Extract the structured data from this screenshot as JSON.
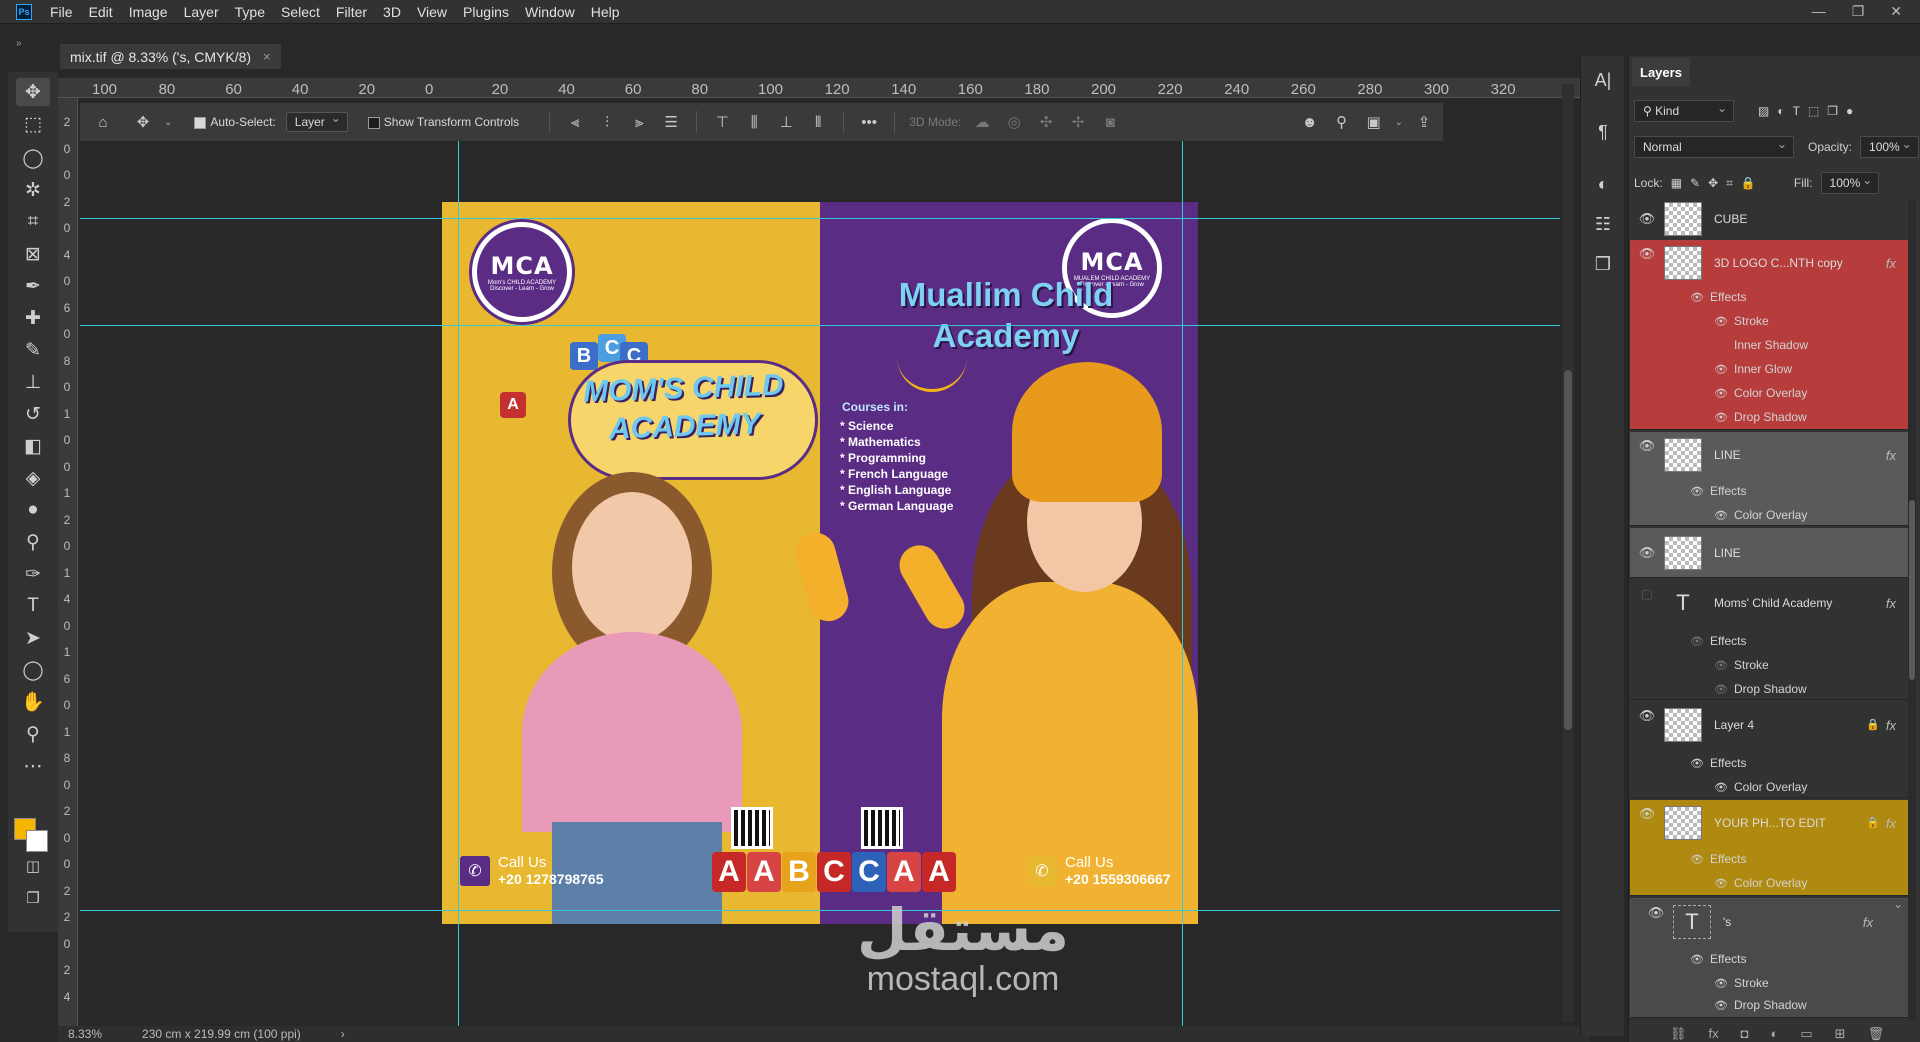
{
  "menubar": {
    "app_logo": "Ps",
    "items": [
      "File",
      "Edit",
      "Image",
      "Layer",
      "Type",
      "Select",
      "Filter",
      "3D",
      "View",
      "Plugins",
      "Window",
      "Help"
    ],
    "window_controls": [
      "—",
      "❐",
      "✕"
    ]
  },
  "document": {
    "tab_title": "mix.tif @ 8.33% ('s, CMYK/8)",
    "close": "×",
    "collapse": "»"
  },
  "ruler": {
    "h_ticks": [
      "100",
      "80",
      "60",
      "40",
      "20",
      "0",
      "20",
      "40",
      "60",
      "80",
      "100",
      "120",
      "140",
      "160",
      "180",
      "200",
      "220",
      "240",
      "260",
      "280",
      "300",
      "320"
    ],
    "v_ticks": [
      "2",
      "0",
      "0",
      "2",
      "0",
      "4",
      "0",
      "6",
      "0",
      "8",
      "0",
      "1",
      "0",
      "0",
      "1",
      "2",
      "0",
      "1",
      "4",
      "0",
      "1",
      "6",
      "0",
      "1",
      "8",
      "0",
      "2",
      "0",
      "0",
      "2",
      "2",
      "0",
      "2",
      "4"
    ]
  },
  "options": {
    "auto_select_label": "Auto-Select:",
    "auto_select_target": "Layer",
    "show_transform": "Show Transform Controls",
    "mode_3d": "3D Mode:",
    "more": "•••"
  },
  "colors": {
    "foreground": "#f7b500",
    "background": "#ffffff",
    "guide": "#36c8d6",
    "art_yellow": "#e8b830",
    "art_purple": "#5a2c84"
  },
  "artwork": {
    "logo_text": "MCA",
    "logo_ring_left": "Mom's CHILD ACADEMY",
    "logo_ring_bottom": "Discover - Learn - Grow",
    "logo_ring_right": "MUALEM CHILD ACADEMY",
    "title_right_1": "Muallim Child",
    "title_right_2": "Academy",
    "title_left_1": "MOM'S CHILD",
    "title_left_2": "ACADEMY",
    "abc_blocks_top": [
      "B",
      "C",
      "C"
    ],
    "cube_letter": "A",
    "courses_heading": "Courses in:",
    "courses": [
      "* Science",
      "* Mathematics",
      "* Programming",
      "* French Language",
      "* English Language",
      "* German Language"
    ],
    "blocks": [
      "A",
      "A",
      "B",
      "C",
      "C",
      "A",
      "A"
    ],
    "call_label": "Call Us",
    "phone_left": "+20 1278798765",
    "phone_right": "+20 1559306667"
  },
  "watermark": {
    "arabic": "مستقل",
    "latin": "mostaql.com"
  },
  "status": {
    "zoom": "8.33%",
    "doc_size": "230 cm x 219.99 cm (100 ppi)",
    "arrow": "›"
  },
  "layers_panel": {
    "tab": "Layers",
    "kind": "Kind",
    "blend_mode": "Normal",
    "opacity_label": "Opacity:",
    "opacity_value": "100%",
    "lock_label": "Lock:",
    "fill_label": "Fill:",
    "fill_value": "100%",
    "layers": [
      {
        "name": "CUBE"
      },
      {
        "name": "3D LOGO C...NTH copy",
        "fx": "fx",
        "effects_label": "Effects",
        "effects": [
          "Stroke",
          "Inner Shadow",
          "Inner Glow",
          "Color Overlay",
          "Drop Shadow"
        ]
      },
      {
        "name": "LINE",
        "fx": "fx",
        "effects_label": "Effects",
        "effects": [
          "Color Overlay"
        ]
      },
      {
        "name": "LINE"
      },
      {
        "name": "Moms' Child Academy",
        "fx": "fx",
        "effects_label": "Effects",
        "effects": [
          "Stroke",
          "Drop Shadow"
        ]
      },
      {
        "name": "Layer 4",
        "fx": "fx",
        "effects_label": "Effects",
        "effects": [
          "Color Overlay"
        ]
      },
      {
        "name": "YOUR PH...TO EDIT",
        "fx": "fx",
        "effects_label": "Effects",
        "effects": [
          "Color Overlay"
        ]
      },
      {
        "name": "'s",
        "fx": "fx",
        "effects_label": "Effects",
        "effects": [
          "Stroke",
          "Drop Shadow"
        ]
      }
    ],
    "text_thumb": "T"
  }
}
